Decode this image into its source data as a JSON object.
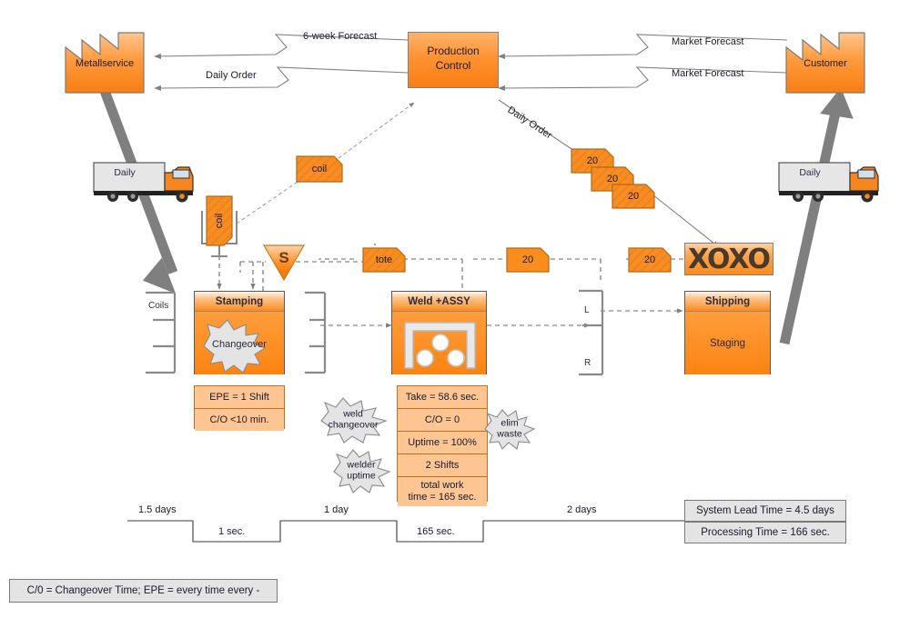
{
  "diagram": {
    "title": "Value Stream Map",
    "colors": {
      "orange_fill": "#fb8c1e",
      "orange_light": "#ffb36b",
      "data_box_fill": "#fcc592",
      "grey_fill": "#e4e4e4",
      "line_grey": "#808080",
      "material_arrow": "#7f7f7f"
    }
  },
  "external": {
    "supplier": {
      "name": "Metallservice"
    },
    "customer": {
      "name": "Customer"
    },
    "control": {
      "name": "Production\nControl",
      "line1": "Production",
      "line2": "Control"
    }
  },
  "info_flows": [
    {
      "id": "six-week-forecast",
      "label": "6-week Forecast"
    },
    {
      "id": "daily-order-supplier",
      "label": "Daily Order"
    },
    {
      "id": "market-forecast-top",
      "label": "Market Forecast"
    },
    {
      "id": "market-forecast-bottom",
      "label": "Market Forecast"
    },
    {
      "id": "daily-order-customer",
      "label": "Daily Order"
    }
  ],
  "shipments": [
    {
      "id": "inbound-truck",
      "label": "Daily"
    },
    {
      "id": "outbound-truck",
      "label": "Daily"
    }
  ],
  "kanban_cards": [
    {
      "id": "kanban-coil-upper",
      "label": "coil",
      "hatched": true
    },
    {
      "id": "kanban-coil-inventory",
      "label": "coil",
      "hatched": true,
      "vertical": true
    },
    {
      "id": "kanban-tote",
      "label": "tote",
      "hatched": true
    },
    {
      "id": "kanban-20-stack-1",
      "label": "20",
      "hatched": true
    },
    {
      "id": "kanban-20-stack-2",
      "label": "20",
      "hatched": true
    },
    {
      "id": "kanban-20-stack-3",
      "label": "20",
      "hatched": true
    },
    {
      "id": "kanban-20-mid",
      "label": "20",
      "hatched": false
    },
    {
      "id": "kanban-20-right",
      "label": "20",
      "hatched": true
    }
  ],
  "signals": [
    {
      "id": "signal-kanban",
      "label": "S"
    }
  ],
  "supermarkets": [
    {
      "id": "supermarket-coils",
      "label": "Coils"
    },
    {
      "id": "supermarket-stamping-out",
      "label": ""
    },
    {
      "id": "supermarket-weld-out-upper",
      "label": "L"
    },
    {
      "id": "supermarket-weld-out-lower",
      "label": "R"
    }
  ],
  "processes": [
    {
      "id": "stamping",
      "title": "Stamping",
      "burst_label": "Changeover",
      "data": [
        "EPE = 1 Shift",
        "C/O <10 min."
      ]
    },
    {
      "id": "weld-assy",
      "title": "Weld +ASSY",
      "data": [
        "Take = 58.6 sec.",
        "C/O = 0",
        "Uptime = 100%",
        "2 Shifts",
        "total work\ntime = 165 sec."
      ]
    },
    {
      "id": "shipping",
      "title": "Shipping",
      "body_label": "Staging"
    }
  ],
  "xoxo": {
    "label": "XOXO"
  },
  "kaizen_bursts": [
    {
      "id": "kaizen-weld-changeover",
      "line1": "weld",
      "line2": "changeover"
    },
    {
      "id": "kaizen-welder-uptime",
      "line1": "welder",
      "line2": "uptime"
    },
    {
      "id": "kaizen-elim-waste",
      "line1": "elim",
      "line2": "waste"
    }
  ],
  "timeline": {
    "lead_times": [
      "1.5 days",
      "1 day",
      "2 days"
    ],
    "process_times": [
      "1 sec.",
      "165 sec."
    ],
    "summary": [
      "System Lead Time = 4.5 days",
      "Processing Time = 166 sec."
    ]
  },
  "legend": {
    "text": "C/0 = Changeover Time; EPE = every time every -"
  }
}
